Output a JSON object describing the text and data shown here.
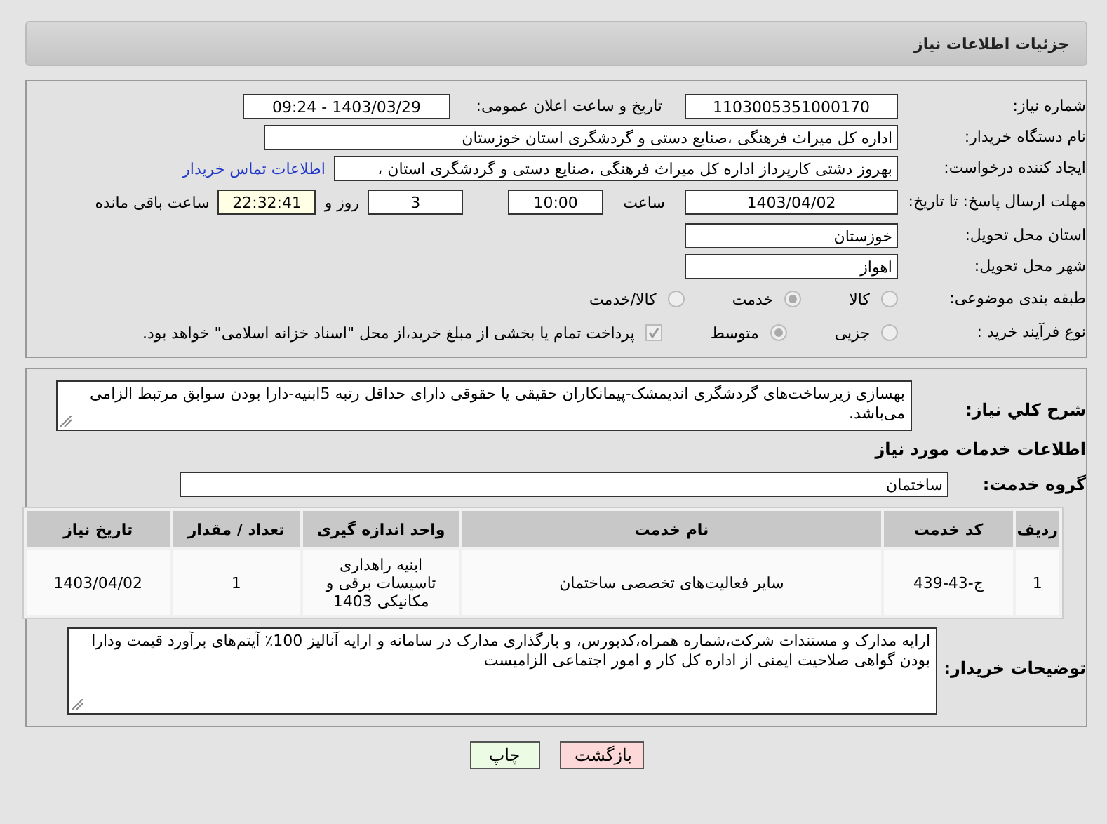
{
  "header": {
    "title": "جزئیات اطلاعات نیاز"
  },
  "details": {
    "need_number": {
      "label": "شماره نیاز:",
      "value": "1103005351000170"
    },
    "announce": {
      "label": "تاریخ و ساعت اعلان عمومی:",
      "value": "1403/03/29 - 09:24"
    },
    "buyer": {
      "label": "نام دستگاه خریدار:",
      "value": "اداره کل میراث فرهنگی ،صنایع دستی و گردشگری استان خوزستان"
    },
    "creator": {
      "label": "ایجاد کننده درخواست:",
      "value": "بهروز دشتی کارپرداز اداره کل میراث فرهنگی ،صنایع دستی و گردشگری استان ،",
      "link": "اطلاعات تماس خریدار"
    },
    "deadline": {
      "label": "مهلت ارسال پاسخ: تا تاریخ:",
      "date": "1403/04/02",
      "time_label": "ساعت",
      "time": "10:00",
      "days": "3",
      "days_label": "روز و",
      "remaining": "22:32:41",
      "remaining_label": "ساعت باقی مانده"
    },
    "province": {
      "label": "استان محل تحویل:",
      "value": "خوزستان"
    },
    "city": {
      "label": "شهر محل تحویل:",
      "value": "اهواز"
    },
    "category": {
      "label": "طبقه بندی موضوعی:",
      "options": [
        {
          "label": "کالا",
          "selected": false
        },
        {
          "label": "خدمت",
          "selected": true
        },
        {
          "label": "کالا/خدمت",
          "selected": false
        }
      ]
    },
    "process": {
      "label": "نوع فرآیند خرید :",
      "options": [
        {
          "label": "جزیی",
          "selected": false
        },
        {
          "label": "متوسط",
          "selected": true
        }
      ],
      "treasury": {
        "checked": true,
        "text": "پرداخت تمام یا بخشی از مبلغ خرید،از محل \"اسناد خزانه اسلامی\" خواهد بود."
      }
    }
  },
  "summary": {
    "label": "شرح کلي نياز:",
    "text": "بهسازی زیرساخت‌های گردشگری اندیمشک-پیمانکاران حقیقی یا حقوقی دارای حداقل رتبه 5ابنیه-دارا بودن سوابق مرتبط الزامی می‌باشد."
  },
  "services_title": "اطلاعات خدمات مورد نیاز",
  "service_group": {
    "label": "گروه خدمت:",
    "value": "ساختمان"
  },
  "table": {
    "columns": [
      "ردیف",
      "کد خدمت",
      "نام خدمت",
      "واحد اندازه گیری",
      "تعداد / مقدار",
      "تاریخ نیاز"
    ],
    "rows": [
      [
        "1",
        "ج-43-439",
        "سایر فعالیت‌های تخصصی ساختمان",
        "ابنیه راهداری تاسیسات برقی و مکانیکی 1403",
        "1",
        "1403/04/02"
      ]
    ]
  },
  "buyer_notes": {
    "label": "توضیحات خریدار:",
    "text": "ارایه مدارک و مستندات شرکت،شماره همراه،کدبورس، و بارگذاری مدارک در سامانه و ارایه آنالیز 100٪ آیتم‌های برآورد قیمت ودارا بودن گواهی صلاحیت ایمنی از اداره کل کار و امور اجتماعی الزامیست"
  },
  "buttons": [
    {
      "kind": "back",
      "label": "بازگشت"
    },
    {
      "kind": "print",
      "label": "چاپ"
    }
  ]
}
